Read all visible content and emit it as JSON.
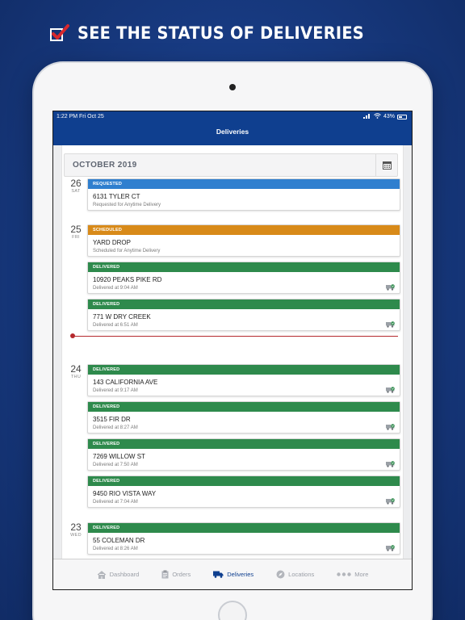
{
  "headline": {
    "text": "SEE THE STATUS OF DELIVERIES"
  },
  "status_bar": {
    "time": "1:22 PM  Fri Oct 25",
    "battery": "43%"
  },
  "nav": {
    "title": "Deliveries"
  },
  "month": {
    "label": "OCTOBER 2019",
    "calendar_icon": "calendar-icon"
  },
  "dates": [
    {
      "day": "26",
      "dow": "SAT"
    },
    {
      "day": "25",
      "dow": "FRI"
    },
    {
      "day": "24",
      "dow": "THU"
    },
    {
      "day": "23",
      "dow": "WED"
    }
  ],
  "colors": {
    "requested": "#2f7fcf",
    "scheduled": "#d88a19",
    "delivered": "#2e8a4c",
    "nav": "#0f3f8f",
    "now_line": "#b5292d"
  },
  "deliveries": [
    {
      "status": "REQUESTED",
      "address": "6131 TYLER CT",
      "detail": "Requested for Anytime Delivery",
      "icon": ""
    },
    {
      "status": "SCHEDULED",
      "address": "YARD DROP",
      "detail": "Scheduled for Anytime Delivery",
      "icon": ""
    },
    {
      "status": "DELIVERED",
      "address": "10920 PEAKS PIKE RD",
      "detail": "Delivered at 9:04 AM",
      "icon": "delivered-truck-icon"
    },
    {
      "status": "DELIVERED",
      "address": "771 W DRY CREEK",
      "detail": "Delivered at 6:51 AM",
      "icon": "delivered-truck-icon"
    },
    {
      "status": "DELIVERED",
      "address": "143 CALIFORNIA AVE",
      "detail": "Delivered at 9:17 AM",
      "icon": "delivered-truck-icon"
    },
    {
      "status": "DELIVERED",
      "address": "3515 FIR DR",
      "detail": "Delivered at 8:27 AM",
      "icon": "delivered-truck-icon"
    },
    {
      "status": "DELIVERED",
      "address": "7269 WILLOW ST",
      "detail": "Delivered at 7:50 AM",
      "icon": "delivered-truck-icon"
    },
    {
      "status": "DELIVERED",
      "address": "9450 RIO VISTA WAY",
      "detail": "Delivered at 7:04 AM",
      "icon": "delivered-truck-icon"
    },
    {
      "status": "DELIVERED",
      "address": "55 COLEMAN DR",
      "detail": "Delivered at 8:26 AM",
      "icon": "delivered-truck-icon"
    }
  ],
  "tabs": [
    {
      "label": "Dashboard",
      "icon": "home-icon"
    },
    {
      "label": "Orders",
      "icon": "clipboard-icon"
    },
    {
      "label": "Deliveries",
      "icon": "truck-icon"
    },
    {
      "label": "Locations",
      "icon": "compass-icon"
    },
    {
      "label": "More",
      "icon": "more-dots-icon"
    }
  ]
}
